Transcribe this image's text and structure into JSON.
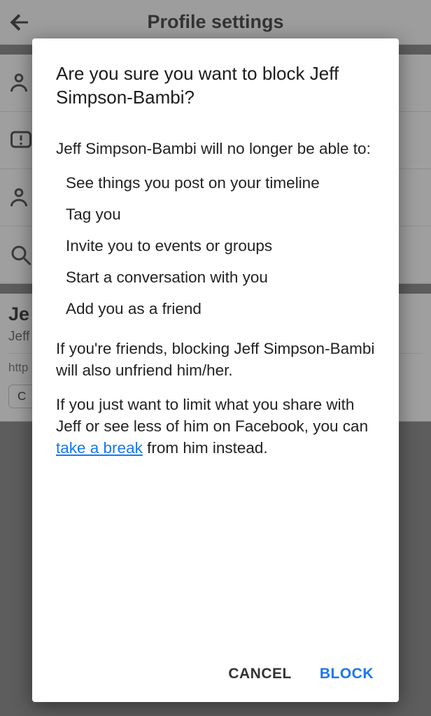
{
  "header": {
    "title": "Profile settings"
  },
  "background": {
    "name_fragment": "Je",
    "sub_fragment": "Jeff",
    "url_fragment": "http",
    "chip_fragment": "C"
  },
  "modal": {
    "title": "Are you sure you want to block Jeff Simpson-Bambi?",
    "lead": "Jeff Simpson-Bambi will no longer be able to:",
    "bullets": [
      "See things you post on your timeline",
      "Tag you",
      "Invite you to events or groups",
      "Start a conversation with you",
      "Add you as a friend"
    ],
    "unfriend_note": "If you're friends, blocking Jeff Simpson-Bambi will also unfriend him/her.",
    "limit_prefix": "If you just want to limit what you share with Jeff or see less of him on Facebook, you can ",
    "limit_link": "take a break",
    "limit_suffix": " from him instead.",
    "cancel": "CANCEL",
    "block": "BLOCK"
  }
}
